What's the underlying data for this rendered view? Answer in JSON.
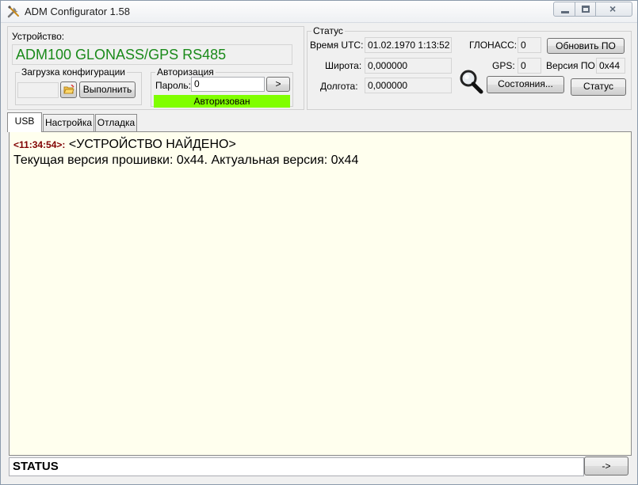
{
  "window": {
    "title": "ADM Configurator 1.58",
    "close_glyph": "×"
  },
  "device": {
    "label": "Устройство:",
    "name": "ADM100 GLONASS/GPS RS485",
    "name_color": "#1a8a1a"
  },
  "config_load": {
    "label": "Загрузка конфигурации",
    "file_value": "",
    "execute_label": "Выполнить"
  },
  "auth": {
    "label": "Авторизация",
    "password_label": "Пароль:",
    "password_value": "0",
    "go_label": ">",
    "status": "Авторизован",
    "status_color": "#80ff00"
  },
  "status": {
    "label": "Статус",
    "utc_label": "Время UTC:",
    "utc_value": "01.02.1970 1:13:52",
    "lat_label": "Широта:",
    "lat_value": "0,000000",
    "lon_label": "Долгота:",
    "lon_value": "0,000000",
    "glonass_label": "ГЛОНАСС:",
    "glonass_value": "0",
    "gps_label": "GPS:",
    "gps_value": "0",
    "fw_label": "Версия ПО:",
    "fw_value": "0x44",
    "update_fw_label": "Обновить ПО",
    "states_label": "Состояния...",
    "status_button_label": "Статус"
  },
  "tabs": [
    {
      "label": "USB",
      "active": true
    },
    {
      "label": "Настройка",
      "active": false
    },
    {
      "label": "Отладка",
      "active": false
    }
  ],
  "log": {
    "line1_time": "<11:34:54>:",
    "line1_text": "<УСТРОЙСТВО НАЙДЕНО>",
    "line2_text": "Текущая версия прошивки: 0x44. Актуальная версия: 0x44"
  },
  "statusbar": {
    "text": "STATUS",
    "arrow_label": "->"
  }
}
